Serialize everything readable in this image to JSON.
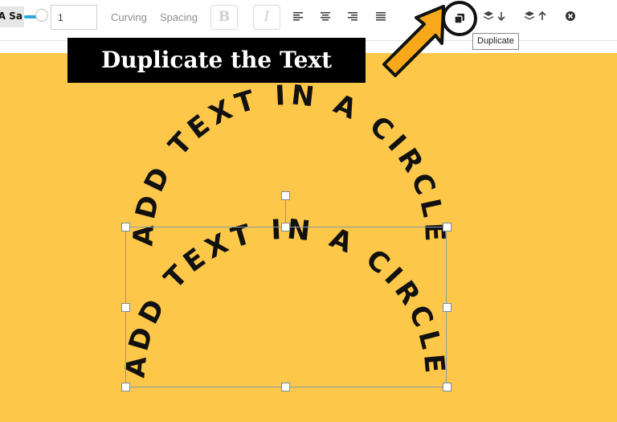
{
  "toolbar": {
    "font_preview": "A Sa",
    "size_value": "1",
    "curving_label": "Curving",
    "spacing_label": "Spacing",
    "bold_label": "B",
    "italic_label": "I",
    "icons": [
      "align-left-icon",
      "align-center-icon",
      "align-right-icon",
      "align-justify-icon",
      "duplicate-icon",
      "layer-down-icon",
      "layer-up-icon",
      "close-icon"
    ],
    "tooltip": "Duplicate"
  },
  "canvas": {
    "background": "#fdc84a",
    "banner_text": "Duplicate the Text",
    "arc_text_top": "ADD TEXT IN A CIRCLE",
    "arc_text_bottom": "ADD TEXT IN A CIRCLE"
  },
  "colors": {
    "accent": "#2aa9e0",
    "arrow_fill": "#f7a81b",
    "text": "#111111"
  }
}
